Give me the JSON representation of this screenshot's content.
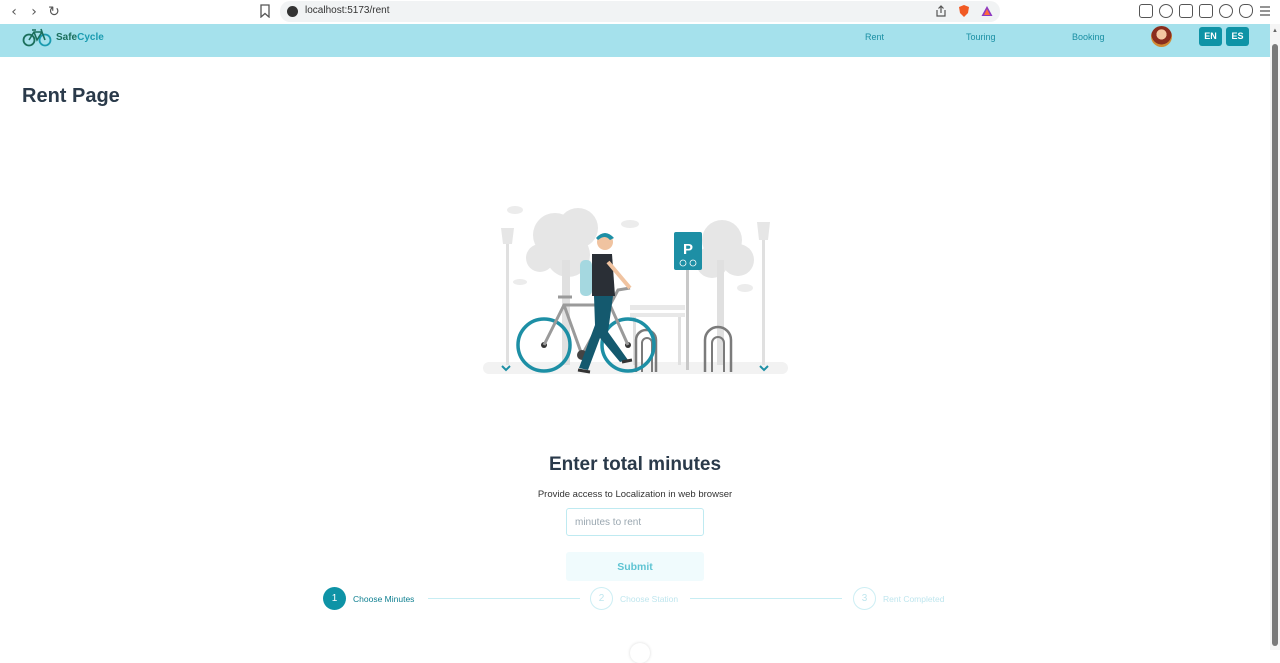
{
  "browser": {
    "url": "localhost:5173/rent"
  },
  "header": {
    "brand": "SafeCycle",
    "nav": [
      {
        "label": "Rent"
      },
      {
        "label": "Touring"
      },
      {
        "label": "Booking"
      }
    ],
    "languages": [
      {
        "label": "EN"
      },
      {
        "label": "ES"
      }
    ]
  },
  "main": {
    "page_title": "Rent Page",
    "form": {
      "heading": "Enter total minutes",
      "subtitle": "Provide access to Localization in web browser",
      "input_placeholder": "minutes to rent",
      "input_value": "",
      "submit_label": "Submit"
    },
    "stepper": [
      {
        "number": "1",
        "label": "Choose Minutes",
        "active": true
      },
      {
        "number": "2",
        "label": "Choose Station",
        "active": false
      },
      {
        "number": "3",
        "label": "Rent Completed",
        "active": false
      }
    ],
    "illustration": {
      "parking_sign": "P"
    }
  },
  "colors": {
    "header_bg": "#a5e1ec",
    "accent": "#0e93a6",
    "title_text": "#2a3a4a"
  }
}
